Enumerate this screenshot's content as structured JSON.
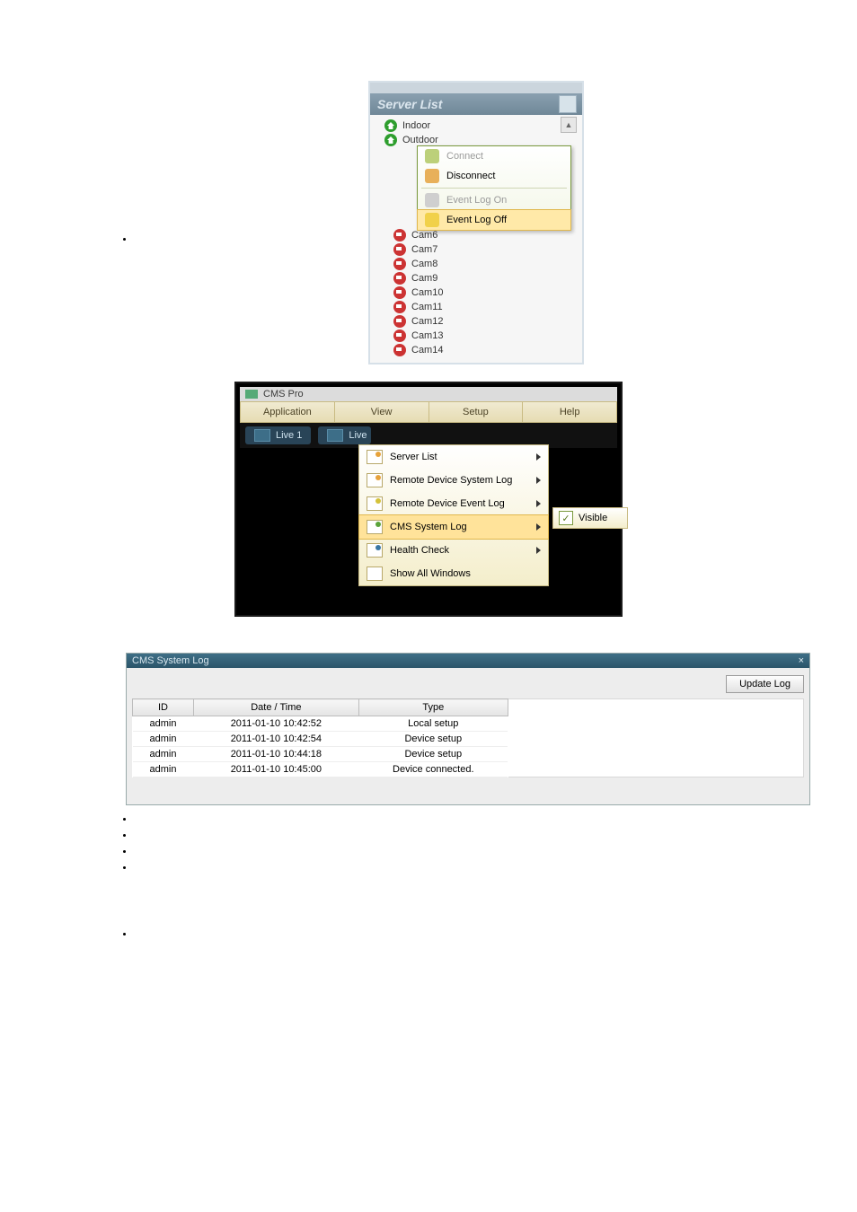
{
  "serverlist": {
    "title": "Server List",
    "groups": [
      "Indoor",
      "Outdoor"
    ],
    "context": {
      "connect": "Connect",
      "disconnect": "Disconnect",
      "event_on": "Event Log On",
      "event_off": "Event Log Off"
    },
    "cams": [
      "Cam6",
      "Cam7",
      "Cam8",
      "Cam9",
      "Cam10",
      "Cam11",
      "Cam12",
      "Cam13",
      "Cam14"
    ]
  },
  "cmspro": {
    "title": "CMS Pro",
    "menus": [
      "Application",
      "View",
      "Setup",
      "Help"
    ],
    "live_button": "Live 1",
    "live_button2": "Live",
    "view_items": [
      "Server List",
      "Remote Device System Log",
      "Remote Device Event Log",
      "CMS System Log",
      "Health Check",
      "Show All Windows"
    ],
    "submenu_label": "Visible"
  },
  "syslog": {
    "title": "CMS System Log",
    "update_btn": "Update Log",
    "columns": [
      "ID",
      "Date / Time",
      "Type"
    ],
    "rows": [
      {
        "id": "admin",
        "dt": "2011-01-10 10:42:52",
        "type": "Local setup"
      },
      {
        "id": "admin",
        "dt": "2011-01-10 10:42:54",
        "type": "Device setup"
      },
      {
        "id": "admin",
        "dt": "2011-01-10 10:44:18",
        "type": "Device setup"
      },
      {
        "id": "admin",
        "dt": "2011-01-10 10:45:00",
        "type": "Device connected."
      }
    ]
  }
}
